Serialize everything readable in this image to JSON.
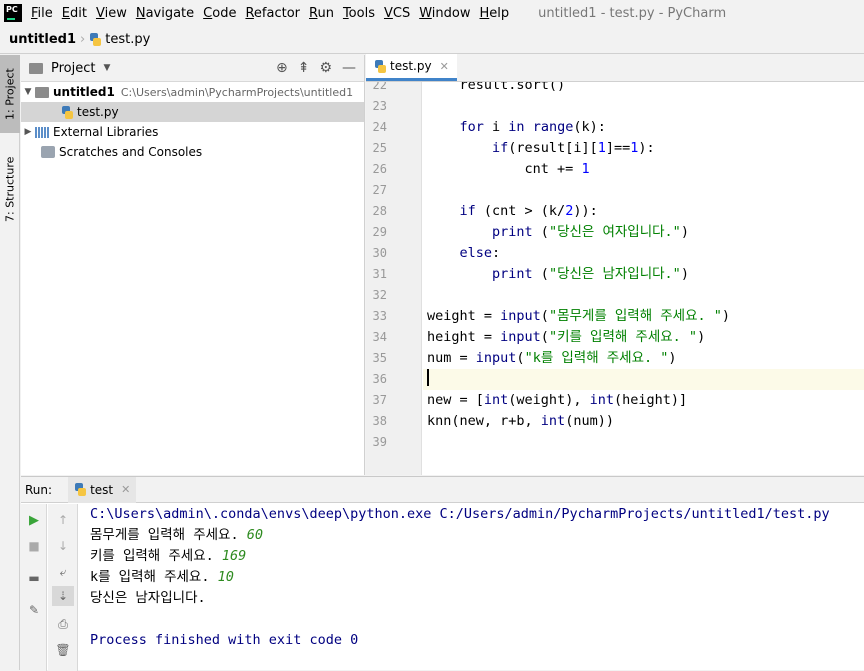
{
  "window": {
    "title": "untitled1 - test.py - PyCharm",
    "logo": "PC"
  },
  "menu": [
    "File",
    "Edit",
    "View",
    "Navigate",
    "Code",
    "Refactor",
    "Run",
    "Tools",
    "VCS",
    "Window",
    "Help"
  ],
  "menu_underline": [
    "F",
    "E",
    "V",
    "N",
    "C",
    "R",
    "R",
    "T",
    "V",
    "W",
    "H"
  ],
  "breadcrumb": {
    "project": "untitled1",
    "file": "test.py"
  },
  "side_tabs": {
    "project": "1: Project",
    "structure": "7: Structure"
  },
  "project_panel": {
    "title": "Project",
    "tree": [
      {
        "label": "untitled1",
        "path": "C:\\Users\\admin\\PycharmProjects\\untitled1"
      },
      {
        "label": "test.py"
      },
      {
        "label": "External Libraries"
      },
      {
        "label": "Scratches and Consoles"
      }
    ]
  },
  "editor": {
    "tab": "test.py",
    "lines": [
      {
        "n": "22",
        "html": "    result.sort()"
      },
      {
        "n": "23",
        "html": ""
      },
      {
        "n": "24",
        "html": "    <span class='kw'>for</span> i <span class='kw'>in</span> <span class='bi'>range</span>(k):"
      },
      {
        "n": "25",
        "html": "        <span class='kw'>if</span>(result[i][<span class='num'>1</span>]==<span class='num'>1</span>):"
      },
      {
        "n": "26",
        "html": "            cnt += <span class='num'>1</span>"
      },
      {
        "n": "27",
        "html": ""
      },
      {
        "n": "28",
        "html": "    <span class='kw'>if</span> (cnt &gt; (k/<span class='num'>2</span>)):"
      },
      {
        "n": "29",
        "html": "        <span class='bi'>print</span> (<span class='str'>\"당신은 여자입니다.\"</span>)"
      },
      {
        "n": "30",
        "html": "    <span class='kw'>else</span>:"
      },
      {
        "n": "31",
        "html": "        <span class='bi'>print</span> (<span class='str'>\"당신은 남자입니다.\"</span>)"
      },
      {
        "n": "32",
        "html": ""
      },
      {
        "n": "33",
        "html": "weight = <span class='bi'>input</span>(<span class='str'>\"몸무게를 입력해 주세요. \"</span>)"
      },
      {
        "n": "34",
        "html": "height = <span class='bi'>input</span>(<span class='str'>\"키를 입력해 주세요. \"</span>)"
      },
      {
        "n": "35",
        "html": "num = <span class='bi'>input</span>(<span class='str'>\"k를 입력해 주세요. \"</span>)"
      },
      {
        "n": "36",
        "html": "<span class='caret'></span>"
      },
      {
        "n": "37",
        "html": "new = [<span class='bi'>int</span>(weight), <span class='bi'>int</span>(height)]"
      },
      {
        "n": "38",
        "html": "knn(new, r+b, <span class='bi'>int</span>(num))"
      },
      {
        "n": "39",
        "html": ""
      }
    ]
  },
  "run_panel": {
    "label": "Run:",
    "tab": "test",
    "console": [
      {
        "text": "C:\\Users\\admin\\.conda\\envs\\deep\\python.exe C:/Users/admin/PycharmProjects/untitled1/test.py",
        "input": ""
      },
      {
        "text": "몸무게를 입력해 주세요. ",
        "input": "60"
      },
      {
        "text": "키를 입력해 주세요. ",
        "input": "169"
      },
      {
        "text": "k를 입력해 주세요. ",
        "input": "10"
      },
      {
        "text": "당신은 남자입니다.",
        "input": ""
      },
      {
        "text": "",
        "input": ""
      },
      {
        "text": "Process finished with exit code 0",
        "input": ""
      }
    ]
  }
}
